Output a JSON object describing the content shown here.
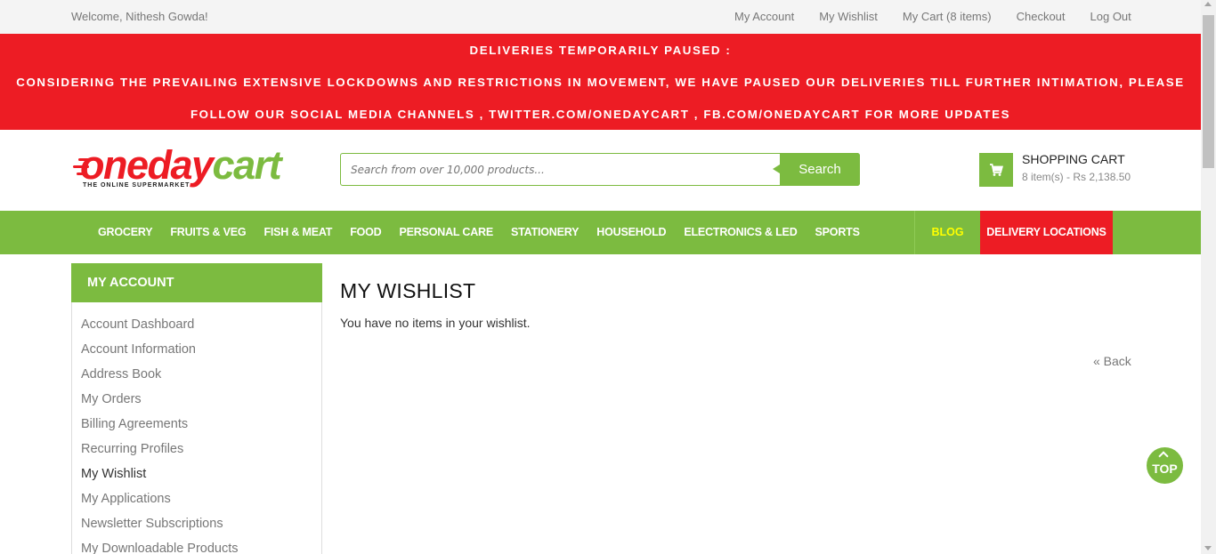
{
  "topbar": {
    "welcome": "Welcome, Nithesh Gowda!",
    "links": [
      "My Account",
      "My Wishlist",
      "My Cart (8 items)",
      "Checkout",
      "Log Out"
    ]
  },
  "notice": {
    "line1": "DELIVERIES TEMPORARILY PAUSED :",
    "line2": "CONSIDERING THE PREVAILING EXTENSIVE LOCKDOWNS AND RESTRICTIONS IN MOVEMENT, WE HAVE PAUSED OUR DELIVERIES TILL FURTHER INTIMATION, PLEASE",
    "line3": "FOLLOW OUR SOCIAL MEDIA CHANNELS , TWITTER.COM/ONEDAYCART , FB.COM/ONEDAYCART FOR MORE UPDATES"
  },
  "logo": {
    "part1": "oneday",
    "part2": "cart",
    "tagline": "THE ONLINE SUPERMARKET"
  },
  "search": {
    "placeholder": "Search from over 10,000 products...",
    "button": "Search"
  },
  "cart": {
    "title": "SHOPPING CART",
    "summary": "8 item(s) - Rs 2,138.50"
  },
  "nav": {
    "items": [
      "GROCERY",
      "FRUITS & VEG",
      "FISH & MEAT",
      "FOOD",
      "PERSONAL CARE",
      "STATIONERY",
      "HOUSEHOLD",
      "ELECTRONICS & LED",
      "SPORTS"
    ],
    "blog": "BLOG",
    "delivery": "DELIVERY LOCATIONS"
  },
  "sidebar": {
    "title": "MY ACCOUNT",
    "items": [
      "Account Dashboard",
      "Account Information",
      "Address Book",
      "My Orders",
      "Billing Agreements",
      "Recurring Profiles",
      "My Wishlist",
      "My Applications",
      "Newsletter Subscriptions",
      "My Downloadable Products"
    ],
    "active": "My Wishlist"
  },
  "main": {
    "title": "MY WISHLIST",
    "empty_message": "You have no items in your wishlist.",
    "back": "« Back"
  },
  "top_button": "TOP",
  "colors": {
    "green": "#7cbb40",
    "red": "#ed1c24",
    "blog": "#ffff00"
  }
}
